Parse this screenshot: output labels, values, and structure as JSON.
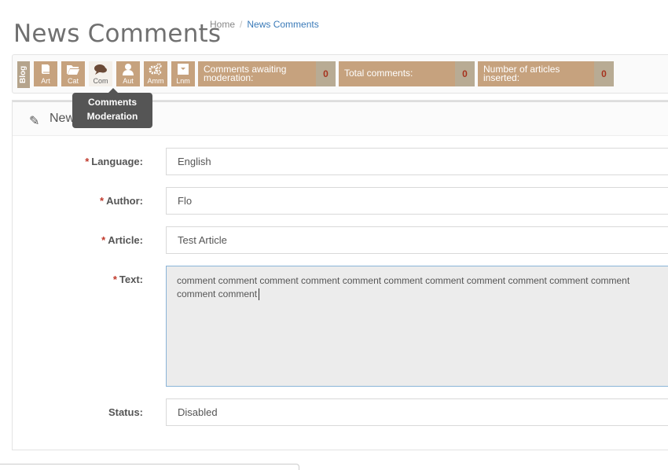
{
  "header": {
    "title": "News Comments",
    "breadcrumb": {
      "home": "Home",
      "separator": "/",
      "current": "News Comments"
    }
  },
  "toolbar": {
    "module_tab": "Blog",
    "tools": [
      {
        "label": "Art",
        "icon": "book-icon"
      },
      {
        "label": "Cat",
        "icon": "folder-open-icon"
      },
      {
        "label": "Com",
        "icon": "comments-icon",
        "active": true
      },
      {
        "label": "Aut",
        "icon": "user-icon"
      },
      {
        "label": "Amm",
        "icon": "gears-icon"
      },
      {
        "label": "Lnm",
        "icon": "dropdown-box-icon"
      }
    ],
    "stats": [
      {
        "label": "Comments awaiting moderation:",
        "count": "0"
      },
      {
        "label": "Total comments:",
        "count": "0"
      },
      {
        "label": "Number of articles inserted:",
        "count": "0"
      }
    ],
    "colors": {
      "tool_bg": "#c6a27e",
      "count_bg": "#b8ab94",
      "count_text": "#a6331f"
    }
  },
  "tooltip": {
    "line1": "Comments",
    "line2": "Moderation"
  },
  "panel": {
    "title": "New",
    "icon": "pencil-icon",
    "required_mark": "*",
    "fields": {
      "language": {
        "label": "Language:",
        "value": "English"
      },
      "author": {
        "label": "Author:",
        "value": "Flo"
      },
      "article": {
        "label": "Article:",
        "value": "Test Article"
      },
      "text": {
        "label": "Text:",
        "value": "comment comment comment comment comment comment comment comment comment comment comment comment comment"
      },
      "status": {
        "label": "Status:",
        "value": "Disabled"
      }
    }
  }
}
